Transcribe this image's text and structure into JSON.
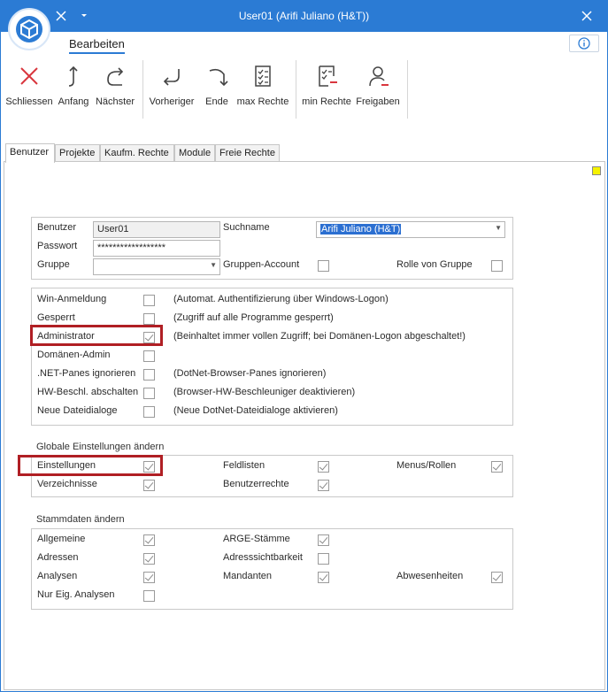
{
  "window": {
    "title": "User01 (Arifi Juliano (H&T))"
  },
  "ribbon": {
    "tab_label": "Bearbeiten",
    "buttons": {
      "close": "Schliessen",
      "first": "Anfang",
      "next": "Nächster",
      "prev": "Vorheriger",
      "last": "Ende",
      "max_rights": "max Rechte",
      "min_rights": "min Rechte",
      "share": "Freigaben"
    }
  },
  "tabs": [
    "Benutzer",
    "Projekte",
    "Kaufm. Rechte",
    "Module",
    "Freie Rechte"
  ],
  "user": {
    "benutzer_label": "Benutzer",
    "benutzer_value": "User01",
    "passwort_label": "Passwort",
    "passwort_value": "******************",
    "gruppe_label": "Gruppe",
    "gruppe_value": "",
    "suchname_label": "Suchname",
    "suchname_value": "Arifi Juliano (H&T)",
    "gruppen_account_label": "Gruppen-Account",
    "gruppen_account_checked": false,
    "rolle_label": "Rolle von Gruppe",
    "rolle_checked": false
  },
  "flags": [
    {
      "label": "Win-Anmeldung",
      "checked": false,
      "desc": "(Automat. Authentifizierung über Windows-Logon)"
    },
    {
      "label": "Gesperrt",
      "checked": false,
      "desc": "(Zugriff auf alle Programme gesperrt)"
    },
    {
      "label": "Administrator",
      "checked": true,
      "desc": "(Beinhaltet immer vollen Zugriff; bei Domänen-Logon abgeschaltet!)"
    },
    {
      "label": "Domänen-Admin",
      "checked": false,
      "desc": ""
    },
    {
      "label": ".NET-Panes ignorieren",
      "checked": false,
      "desc": "(DotNet-Browser-Panes ignorieren)"
    },
    {
      "label": "HW-Beschl. abschalten",
      "checked": false,
      "desc": "(Browser-HW-Beschleuniger deaktivieren)"
    },
    {
      "label": "Neue Dateidialoge",
      "checked": false,
      "desc": "(Neue DotNet-Dateidialoge aktivieren)"
    }
  ],
  "globale": {
    "title": "Globale Einstellungen ändern",
    "items": [
      {
        "label": "Einstellungen",
        "checked": true
      },
      {
        "label": "Verzeichnisse",
        "checked": true
      },
      {
        "label": "Feldlisten",
        "checked": true
      },
      {
        "label": "Benutzerrechte",
        "checked": true
      },
      {
        "label": "Menus/Rollen",
        "checked": true
      }
    ]
  },
  "stammdaten": {
    "title": "Stammdaten ändern",
    "items": [
      {
        "label": "Allgemeine",
        "checked": true
      },
      {
        "label": "Adressen",
        "checked": true
      },
      {
        "label": "Analysen",
        "checked": true
      },
      {
        "label": "Nur Eig. Analysen",
        "checked": false
      },
      {
        "label": "ARGE-Stämme",
        "checked": true
      },
      {
        "label": "Adresssichtbarkeit",
        "checked": false
      },
      {
        "label": "Mandanten",
        "checked": true
      },
      {
        "label": "Abwesenheiten",
        "checked": true
      }
    ]
  },
  "colors": {
    "accent": "#2b7bd4",
    "highlight": "#b01f24",
    "marker": "#f5f200"
  }
}
